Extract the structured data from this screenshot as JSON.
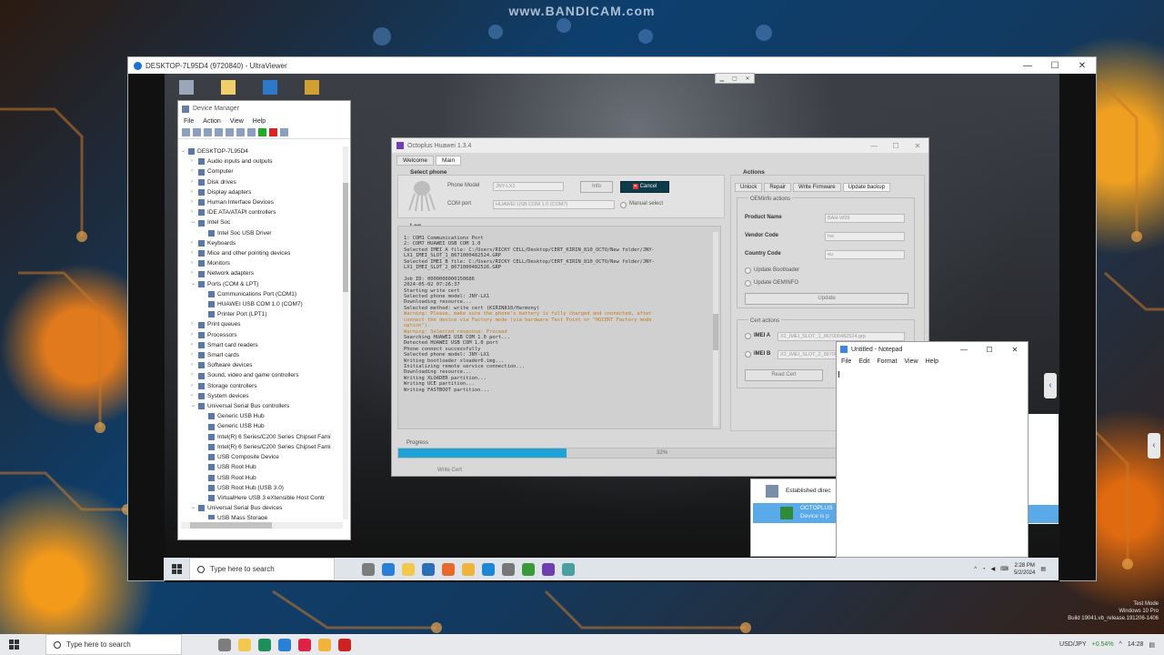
{
  "watermark": "www.BANDICAM.com",
  "ultraviewer": {
    "title": "DESKTOP-7L95D4 (9720840) - UltraViewer"
  },
  "device_manager": {
    "title": "Device Manager",
    "menu": [
      "File",
      "Action",
      "View",
      "Help"
    ],
    "tree": [
      {
        "label": "DESKTOP-7L95D4",
        "level": 0,
        "open": true
      },
      {
        "label": "Audio inputs and outputs",
        "level": 1
      },
      {
        "label": "Computer",
        "level": 1
      },
      {
        "label": "Disk drives",
        "level": 1
      },
      {
        "label": "Display adapters",
        "level": 1
      },
      {
        "label": "Human Interface Devices",
        "level": 1
      },
      {
        "label": "IDE ATA/ATAPI controllers",
        "level": 1
      },
      {
        "label": "Intel Soc",
        "level": 1,
        "open": true
      },
      {
        "label": "Intel Soc USB Driver",
        "level": 2
      },
      {
        "label": "Keyboards",
        "level": 1
      },
      {
        "label": "Mice and other pointing devices",
        "level": 1
      },
      {
        "label": "Monitors",
        "level": 1
      },
      {
        "label": "Network adapters",
        "level": 1
      },
      {
        "label": "Ports (COM & LPT)",
        "level": 1,
        "open": true
      },
      {
        "label": "Communications Port (COM1)",
        "level": 2
      },
      {
        "label": "HUAWEI USB COM 1.0 (COM7)",
        "level": 2
      },
      {
        "label": "Printer Port (LPT1)",
        "level": 2
      },
      {
        "label": "Print queues",
        "level": 1
      },
      {
        "label": "Processors",
        "level": 1
      },
      {
        "label": "Smart card readers",
        "level": 1
      },
      {
        "label": "Smart cards",
        "level": 1
      },
      {
        "label": "Software devices",
        "level": 1
      },
      {
        "label": "Sound, video and game controllers",
        "level": 1
      },
      {
        "label": "Storage controllers",
        "level": 1
      },
      {
        "label": "System devices",
        "level": 1
      },
      {
        "label": "Universal Serial Bus controllers",
        "level": 1,
        "open": true
      },
      {
        "label": "Generic USB Hub",
        "level": 2
      },
      {
        "label": "Generic USB Hub",
        "level": 2
      },
      {
        "label": "Intel(R) 6 Series/C200 Series Chipset Fami",
        "level": 2
      },
      {
        "label": "Intel(R) 6 Series/C200 Series Chipset Fami",
        "level": 2
      },
      {
        "label": "USB Composite Device",
        "level": 2
      },
      {
        "label": "USB Root Hub",
        "level": 2
      },
      {
        "label": "USB Root Hub",
        "level": 2
      },
      {
        "label": "USB Root Hub (USB 3.0)",
        "level": 2
      },
      {
        "label": "VirtualHere USB 3 eXtensible Host Contr",
        "level": 2
      },
      {
        "label": "Universal Serial Bus devices",
        "level": 1,
        "open": true
      },
      {
        "label": "USB Mass Storage",
        "level": 2
      }
    ]
  },
  "octoplus": {
    "title": "Octoplus Huawei 1.3.4",
    "tabs": [
      "Welcome",
      "Main"
    ],
    "select_phone_label": "Select phone",
    "phone_model_label": "Phone Model",
    "phone_model_value": "JNY-LX1",
    "com_port_label": "COM port",
    "com_port_value": "HUAWEI USB COM 1.0 (COM7)",
    "info_button": "Info",
    "cancel_button": "Cancel",
    "manual_select_label": "Manual select",
    "log_label": "Log",
    "log_lines": [
      {
        "t": "1: COM1 Communications Port",
        "w": false
      },
      {
        "t": "2: COM7 HUAWEI USB COM 1.0",
        "w": false
      },
      {
        "t": "Selected IMEI_A file: C:/Users/RICKY CELL/Desktop/CERT_KIRIN_810_OCTO/New folder/JNY-",
        "w": false
      },
      {
        "t": "LX1_IMEI_SLOT_1_8671000482524.GRP",
        "w": false
      },
      {
        "t": "Selected IMEI_B file: C:/Users/RICKY CELL/Desktop/CERT_KIRIN_810_OCTO/New folder/JNY-",
        "w": false
      },
      {
        "t": "LX1_IMEI_SLOT_2_8671000482526.GRP",
        "w": false
      },
      {
        "t": "",
        "w": false
      },
      {
        "t": "Job ID: 0000000000150686",
        "w": false
      },
      {
        "t": "2024-05-02 07:26:37",
        "w": false
      },
      {
        "t": "Starting write cert",
        "w": false
      },
      {
        "t": "Selected phone model: JNY-LX1",
        "w": false
      },
      {
        "t": "Downloading resource...",
        "w": false
      },
      {
        "t": "Selected method: write cert (KIRIN810/Harmony)",
        "w": false
      },
      {
        "t": "Warning: Please, make sure the phone's battery is fully charged and connected, after",
        "w": true
      },
      {
        "t": "connect the device via Factory mode (via hardware Test Point or \"HUCERT Factory mode",
        "w": true
      },
      {
        "t": "option\").",
        "w": true
      },
      {
        "t": "Warning: Selected response: Proceed",
        "w": true
      },
      {
        "t": "Searching HUAWEI USB COM 1.0 port...",
        "w": false
      },
      {
        "t": "Detected HUAWEI USB COM 1.0 port",
        "w": false
      },
      {
        "t": "Phone connect successfully",
        "w": false
      },
      {
        "t": "Selected phone model: JNY-LX1",
        "w": false
      },
      {
        "t": "Writing bootloader xloader6.img...",
        "w": false
      },
      {
        "t": "Initializing remote service connection...",
        "w": false
      },
      {
        "t": "Downloading resource...",
        "w": false
      },
      {
        "t": "Writing XLOADER partition...",
        "w": false
      },
      {
        "t": "Writing UCE partition...",
        "w": false
      },
      {
        "t": "Writing FASTBOOT partition...",
        "w": false
      }
    ],
    "actions_label": "Actions",
    "action_tabs": [
      "Unlock",
      "Repair",
      "Write Firmware",
      "Update backup"
    ],
    "oeminfo_label": "OEMinfo actions",
    "product_name_label": "Product Name",
    "product_name_value": "BAH-W09",
    "vendor_code_label": "Vendor Code",
    "vendor_code_value": "hw",
    "country_code_label": "Country Code",
    "country_code_value": "eu",
    "update_bootloader_label": "Update Bootloader",
    "update_oeminfo_label": "Update OEMINFO",
    "update_button": "Update",
    "cert_actions_label": "Cert actions",
    "imei_a_label": "IMEI A",
    "imei_a_value": "X2_IMEI_SLOT_1_867000482524.grp",
    "imei_b_label": "IMEI B",
    "imei_b_value": "X2_IMEI_SLOT_2_867000482526.grp",
    "read_cert_button": "Read Cert",
    "progress_label": "Progress",
    "progress_percent": 32,
    "progress_text": "32%",
    "status_text": "Write Cert"
  },
  "notepad": {
    "title": "Untitled - Notepad",
    "menu": [
      "File",
      "Edit",
      "Format",
      "View",
      "Help"
    ]
  },
  "established": {
    "header": "Established direc",
    "item_title": "OCTOPLUS",
    "item_sub": "Device is p"
  },
  "remote_taskbar": {
    "search_placeholder": "Type here to search",
    "time": "2:28 PM",
    "date": "5/2/2024"
  },
  "host_taskbar": {
    "search_placeholder": "Type here to search",
    "currency": "USD/JPY",
    "currency_change": "+0.54%",
    "time": "14:28"
  },
  "test_mode": {
    "line1": "Test Mode",
    "line2": "Windows 10 Pro",
    "line3": "Build 19041.vb_release.191206-1406"
  }
}
